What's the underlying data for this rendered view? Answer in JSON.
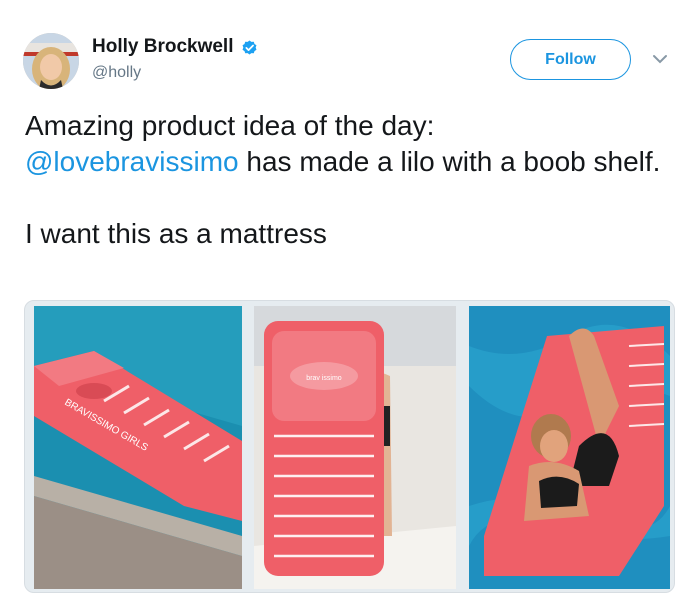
{
  "tweet": {
    "author": {
      "display_name": "Holly Brockwell",
      "handle": "@holly",
      "verified": true,
      "verified_icon": "verified-badge-icon"
    },
    "follow_label": "Follow",
    "caret_icon": "chevron-down-icon",
    "text": {
      "line1": "Amazing product idea of the day:",
      "mention": "@lovebravissimo",
      "line2_rest": " has made a lilo with a boob shelf.",
      "line3": "I want this as a mattress"
    },
    "media": {
      "left_lilo_print": "BRAVISSIMO GIRLS",
      "mid_lilo_badge": "brav issimo"
    }
  },
  "colors": {
    "accent": "#1b95e0",
    "text": "#14171a",
    "muted": "#657786",
    "lilo_coral": "#ef5f68",
    "pool_blue": "#1b8fb0"
  }
}
